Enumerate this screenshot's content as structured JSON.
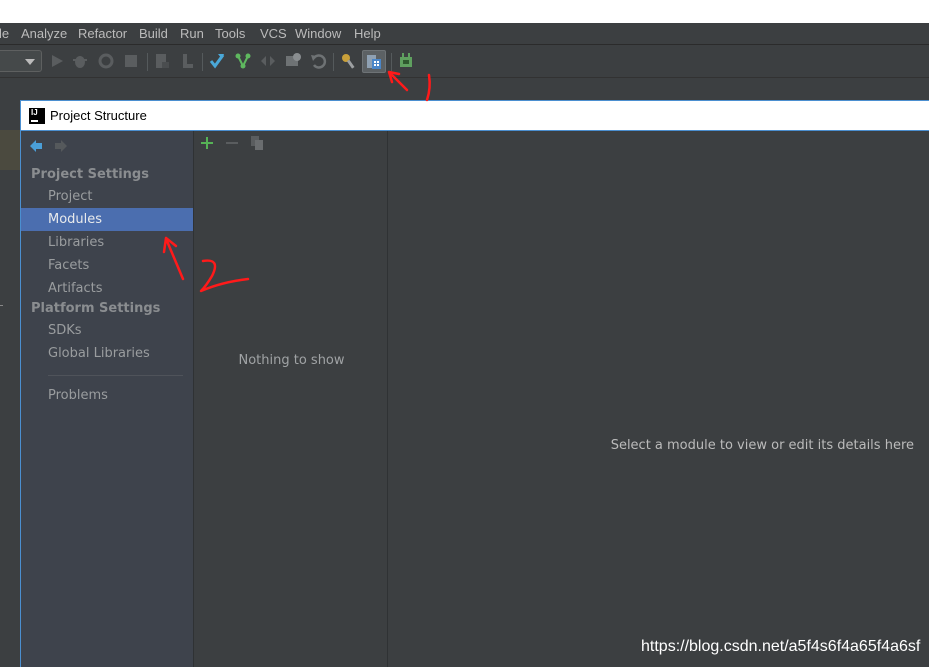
{
  "menu": {
    "items": [
      "le",
      "Analyze",
      "Refactor",
      "Build",
      "Run",
      "Tools",
      "VCS",
      "Window",
      "Help"
    ]
  },
  "toolbar": {
    "icons": [
      "run-icon",
      "debug-icon",
      "coverage-icon",
      "stop-icon",
      "build-icon",
      "profile-icon",
      "vcs-update-icon",
      "vcs-commit-icon",
      "vcs-compare-icon",
      "vcs-history-icon",
      "revert-icon",
      "settings-icon",
      "project-structure-icon",
      "sdk-manager-icon"
    ],
    "active_icon": "project-structure-icon"
  },
  "dialog": {
    "title": "Project Structure",
    "logo_text": "IJ",
    "sidebar": {
      "project_settings_header": "Project Settings",
      "project_settings_items": [
        "Project",
        "Modules",
        "Libraries",
        "Facets",
        "Artifacts"
      ],
      "platform_settings_header": "Platform Settings",
      "platform_settings_items": [
        "SDKs",
        "Global Libraries"
      ],
      "problems": "Problems",
      "selected": "Modules"
    },
    "middle": {
      "empty_text": "Nothing to show"
    },
    "detail": {
      "hint_text": "Select a module to view or edit its details here"
    }
  },
  "annotations": {
    "arrow_1_label": "1",
    "arrow_2_label": "2",
    "color": "#ff0000"
  },
  "watermark": "https://blog.csdn.net/a5f4s6f4a65f4a6sf",
  "colors": {
    "ide_background": "#3c3f41",
    "sidebar_background": "#3e434c",
    "selection": "#4b6eaf",
    "dialog_border": "#4b8fd0"
  }
}
